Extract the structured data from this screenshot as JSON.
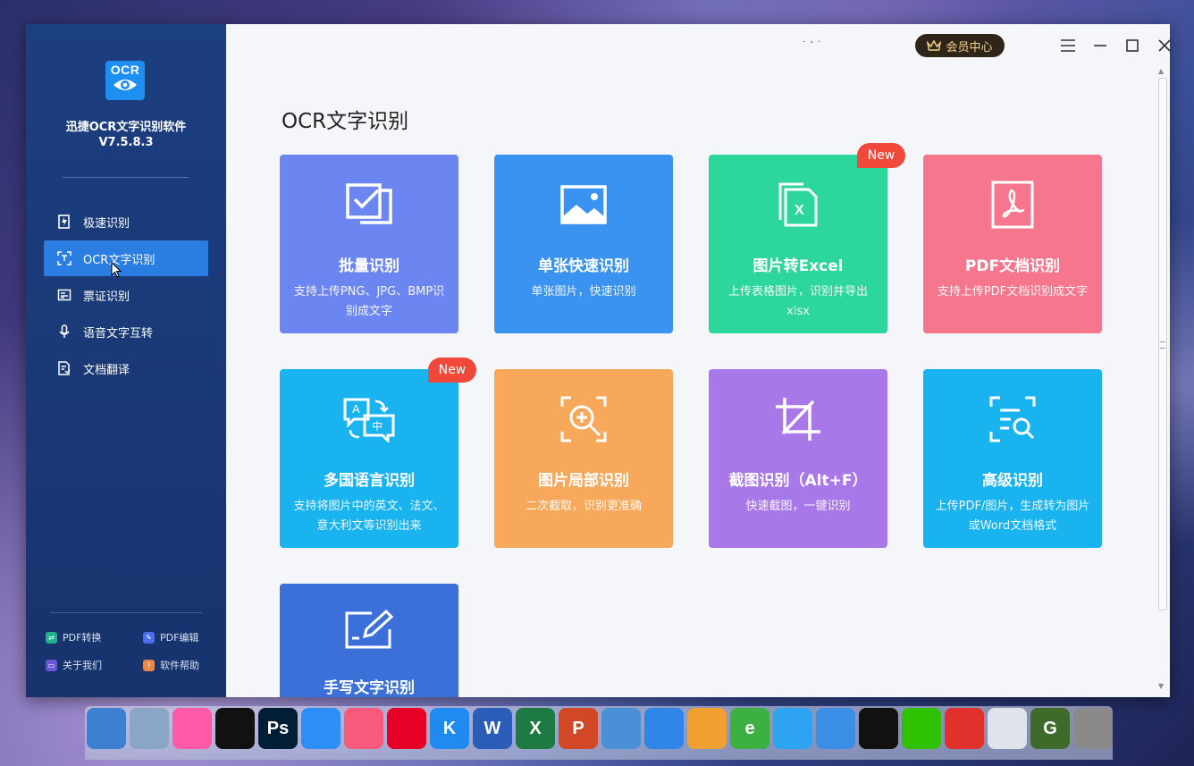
{
  "app": {
    "logo_text": "OCR",
    "name": "迅捷OCR文字识别软件",
    "version": "V7.5.8.3"
  },
  "sidebar": {
    "items": [
      {
        "label": "极速识别",
        "icon": "lightning-doc-icon",
        "active": false
      },
      {
        "label": "OCR文字识别",
        "icon": "scan-text-icon",
        "active": true
      },
      {
        "label": "票证识别",
        "icon": "ticket-icon",
        "active": false
      },
      {
        "label": "语音文字互转",
        "icon": "microphone-icon",
        "active": false
      },
      {
        "label": "文档翻译",
        "icon": "translate-doc-icon",
        "active": false
      }
    ],
    "bottom_links": [
      {
        "label": "PDF转换",
        "icon": "pdf-convert-icon",
        "color": "#22b38a"
      },
      {
        "label": "PDF编辑",
        "icon": "pdf-edit-icon",
        "color": "#4d6df0"
      },
      {
        "label": "关于我们",
        "icon": "about-icon",
        "color": "#6a55d8"
      },
      {
        "label": "软件帮助",
        "icon": "help-icon",
        "color": "#e8884a"
      }
    ]
  },
  "titlebar": {
    "vip_label": "会员中心",
    "dots": "· - ·"
  },
  "main": {
    "title": "OCR文字识别",
    "cards": [
      {
        "title": "批量识别",
        "desc": "支持上传PNG、JPG、BMP识别成文字",
        "color": "#6b86f0",
        "icon": "batch-check-icon",
        "badge": ""
      },
      {
        "title": "单张快速识别",
        "desc": "单张图片，快速识别",
        "color": "#3a93f0",
        "icon": "image-icon",
        "badge": ""
      },
      {
        "title": "图片转Excel",
        "desc": "上传表格图片，识别并导出xlsx",
        "color": "#2dd69a",
        "icon": "excel-icon",
        "badge": "New"
      },
      {
        "title": "PDF文档识别",
        "desc": "支持上传PDF文档识别成文字",
        "color": "#f5768d",
        "icon": "pdf-icon",
        "badge": ""
      },
      {
        "title": "多国语言识别",
        "desc": "支持将图片中的英文、法文、意大利文等识别出来",
        "color": "#19b3f0",
        "icon": "language-icon",
        "badge": "New"
      },
      {
        "title": "图片局部识别",
        "desc": "二次截取，识别更准确",
        "color": "#f8a85a",
        "icon": "zoom-scan-icon",
        "badge": ""
      },
      {
        "title": "截图识别（Alt+F）",
        "desc": "快速截图，一键识别",
        "color": "#a877e8",
        "icon": "crop-icon",
        "badge": ""
      },
      {
        "title": "高级识别",
        "desc": "上传PDF/图片，生成转为图片或Word文档格式",
        "color": "#19b3f0",
        "icon": "doc-search-icon",
        "badge": ""
      },
      {
        "title": "手写文字识别",
        "desc": "",
        "color": "#3a70d8",
        "icon": "handwrite-icon",
        "badge": ""
      }
    ]
  },
  "dock": {
    "apps": [
      {
        "name": "computer-icon",
        "label": "",
        "color": "#3d7fd0"
      },
      {
        "name": "recycle-bin-icon",
        "label": "",
        "color": "#8aa6c6"
      },
      {
        "name": "colorful-clover-icon",
        "label": "",
        "color": "#ff5aa8"
      },
      {
        "name": "ring-icon",
        "label": "",
        "color": "#111111"
      },
      {
        "name": "photoshop-icon",
        "label": "Ps",
        "color": "#001e36"
      },
      {
        "name": "baidu-netdisk-icon",
        "label": "",
        "color": "#2e8ef7"
      },
      {
        "name": "music-icon",
        "label": "",
        "color": "#f75a7a"
      },
      {
        "name": "netease-music-icon",
        "label": "",
        "color": "#e60026"
      },
      {
        "name": "kugou-icon",
        "label": "K",
        "color": "#1f8bf0"
      },
      {
        "name": "word-icon",
        "label": "W",
        "color": "#2b5cb8"
      },
      {
        "name": "excel-app-icon",
        "label": "X",
        "color": "#1d7a43"
      },
      {
        "name": "powerpoint-icon",
        "label": "P",
        "color": "#d24726"
      },
      {
        "name": "chrome-icon",
        "label": "",
        "color": "#4a90d9"
      },
      {
        "name": "cloud-circle-icon",
        "label": "",
        "color": "#2f86e8"
      },
      {
        "name": "pinwheel-icon",
        "label": "",
        "color": "#f0a030"
      },
      {
        "name": "ie-icon",
        "label": "e",
        "color": "#3cb043"
      },
      {
        "name": "feiyu-icon",
        "label": "",
        "color": "#2ea3f2"
      },
      {
        "name": "bird-icon",
        "label": "",
        "color": "#3a8ee6"
      },
      {
        "name": "qq-icon",
        "label": "",
        "color": "#111111"
      },
      {
        "name": "wechat-icon",
        "label": "",
        "color": "#2dc100"
      },
      {
        "name": "xmind-icon",
        "label": "",
        "color": "#e0312d"
      },
      {
        "name": "screen-record-icon",
        "label": "",
        "color": "#dfe4ec"
      },
      {
        "name": "g-app-icon",
        "label": "G",
        "color": "#3e6b2a"
      },
      {
        "name": "tools-icon",
        "label": "",
        "color": "#8a8a8a"
      }
    ]
  }
}
